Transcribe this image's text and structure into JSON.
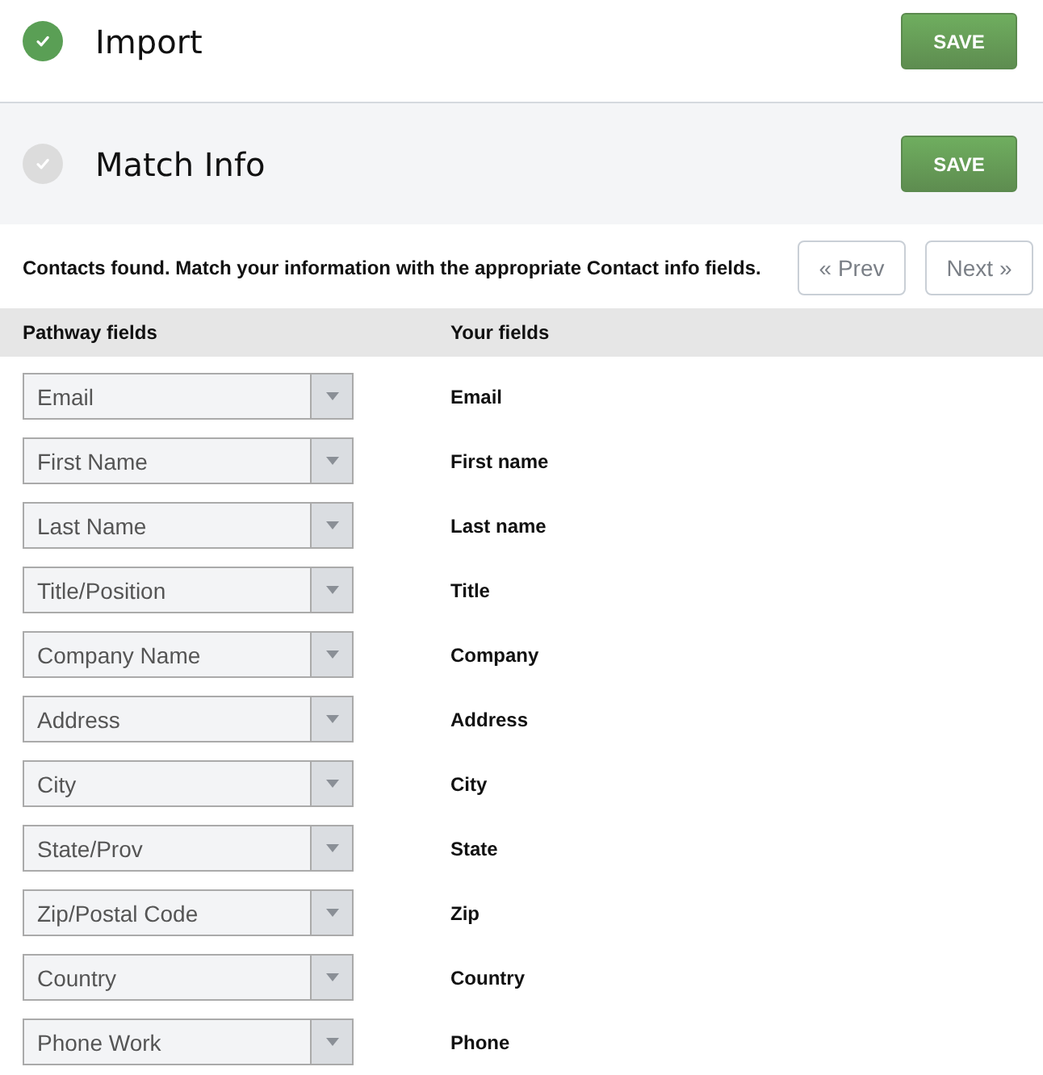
{
  "steps": [
    {
      "title": "Import",
      "done": true,
      "active": false,
      "button": "SAVE"
    },
    {
      "title": "Match Info",
      "done": false,
      "active": true,
      "button": "SAVE"
    }
  ],
  "instruction": "Contacts found. Match your information with the appropriate Contact info fields.",
  "pager": {
    "prev": "« Prev",
    "next": "Next »"
  },
  "table": {
    "columns": [
      "Pathway fields",
      "Your fields"
    ],
    "rows": [
      {
        "pathway_field": "Email",
        "your_field": "Email"
      },
      {
        "pathway_field": "First Name",
        "your_field": "First name"
      },
      {
        "pathway_field": "Last Name",
        "your_field": "Last name"
      },
      {
        "pathway_field": "Title/Position",
        "your_field": "Title"
      },
      {
        "pathway_field": "Company Name",
        "your_field": "Company"
      },
      {
        "pathway_field": "Address",
        "your_field": "Address"
      },
      {
        "pathway_field": "City",
        "your_field": "City"
      },
      {
        "pathway_field": "State/Prov",
        "your_field": "State"
      },
      {
        "pathway_field": "Zip/Postal Code",
        "your_field": "Zip"
      },
      {
        "pathway_field": "Country",
        "your_field": "Country"
      },
      {
        "pathway_field": "Phone Work",
        "your_field": "Phone"
      }
    ]
  }
}
